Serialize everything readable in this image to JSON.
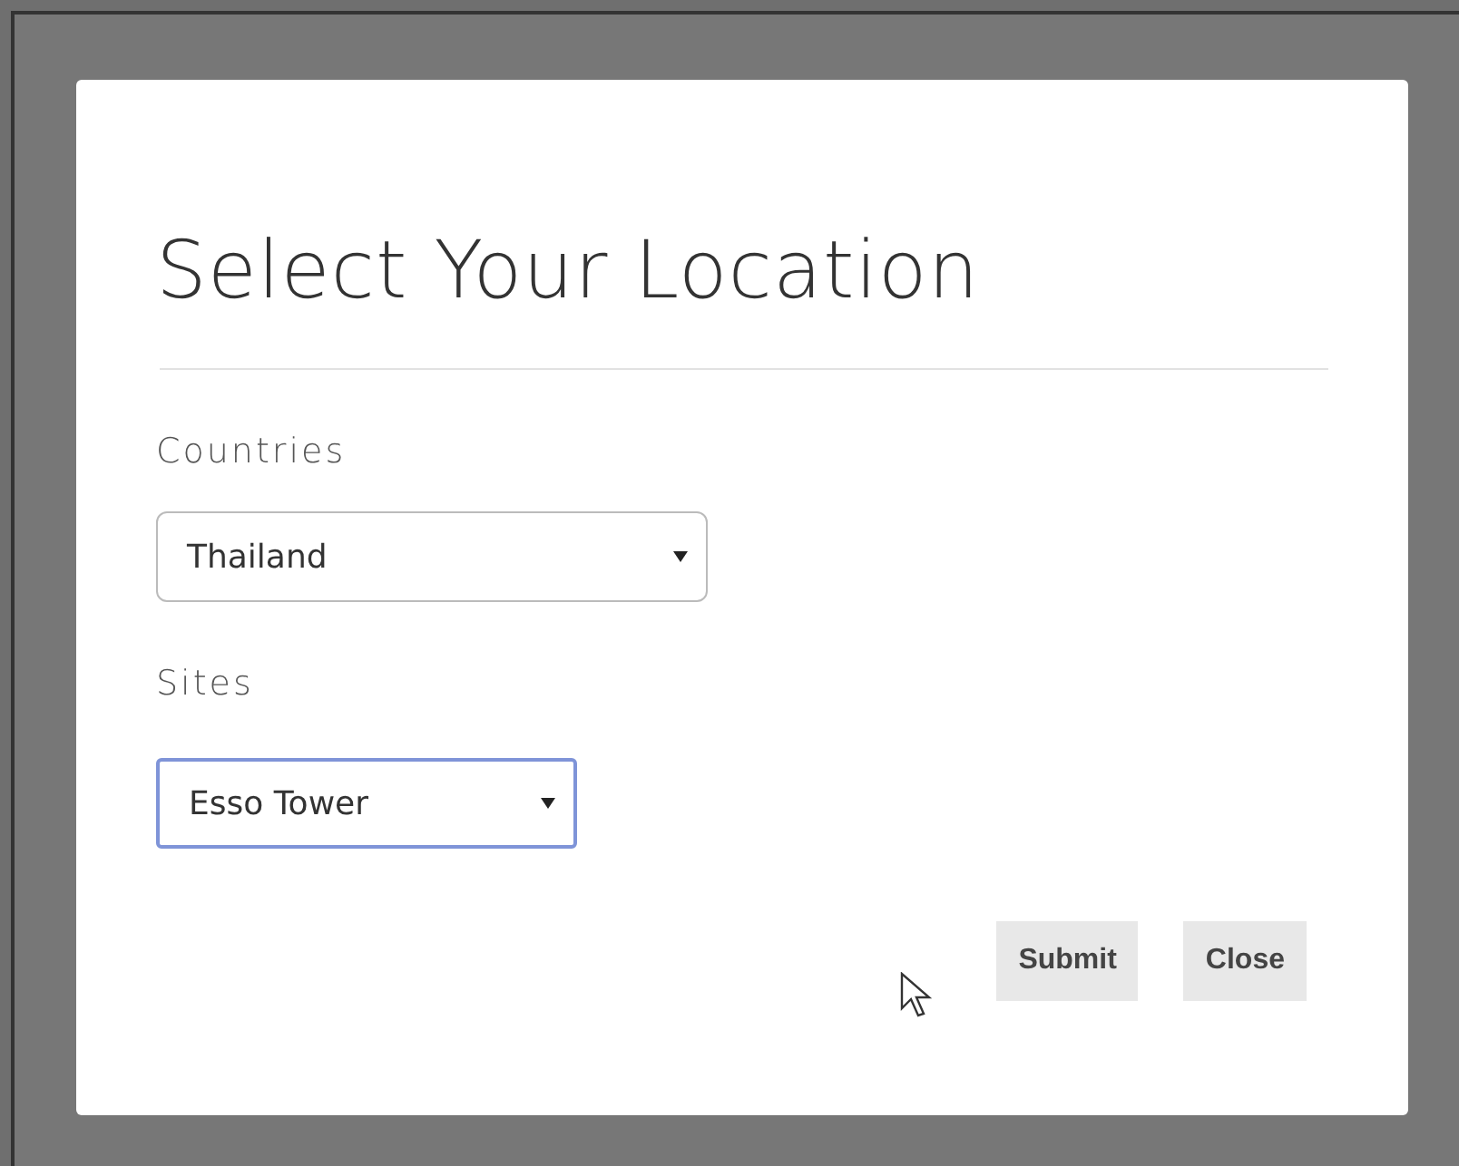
{
  "dialog": {
    "title": "Select Your Location",
    "fields": [
      {
        "label": "Countries",
        "value": "Thailand",
        "focused": false
      },
      {
        "label": "Sites",
        "value": "Esso Tower",
        "focused": true
      }
    ],
    "buttons": [
      {
        "label": "Submit"
      },
      {
        "label": "Close"
      }
    ]
  }
}
